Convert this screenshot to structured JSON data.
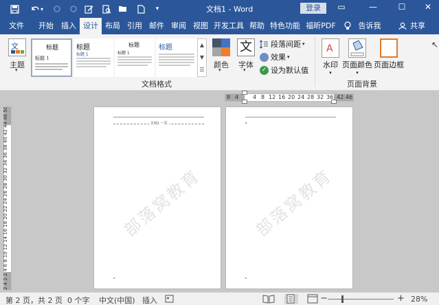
{
  "titlebar": {
    "title": "文档1  -  Word",
    "login": "登录"
  },
  "tabs": [
    "文件",
    "开始",
    "插入",
    "设计",
    "布局",
    "引用",
    "邮件",
    "审阅",
    "视图",
    "开发工具",
    "帮助",
    "特色功能",
    "福昕PDF",
    "告诉我",
    "共享"
  ],
  "ribbon": {
    "themes_label": "主题",
    "gallery": {
      "t1_title": "标题",
      "t1_sub": "标题 1",
      "t2_title": "标题",
      "t2_sub": "标题 1",
      "t3_title": "标题",
      "t3_sub": "标题 1",
      "t4_title": "标题"
    },
    "colors_label": "颜色",
    "fonts_label": "字体",
    "para_spacing": "段落间距",
    "effects": "效果",
    "set_default": "设为默认值",
    "group_doc_format": "文档格式",
    "watermark_label": "水印",
    "page_color": "页面颜色",
    "page_borders": "页面边框",
    "group_page_bg": "页面背景"
  },
  "ruler": {
    "h_ticks": [
      "8",
      "4",
      "4",
      "8",
      "12",
      "16",
      "20",
      "24",
      "28",
      "32",
      "36",
      "42",
      "46"
    ],
    "v_text": "2  4  2  2  4  6  8  10 12 14 16 18 20 22 24 26 28 30 32 34 36 38 40 42 44 46  50 50"
  },
  "pages": {
    "header_text": "文档1 一页",
    "watermark": "部落窝教育"
  },
  "status": {
    "page": "第 2 页，共 2 页",
    "words": "0 个字",
    "lang": "中文(中国)",
    "mode": "插入",
    "zoom": "28%"
  },
  "colors": {
    "brand": "#2b579a",
    "ribbon_bg": "#f3f3f3",
    "canvas": "#c8c8c8"
  }
}
